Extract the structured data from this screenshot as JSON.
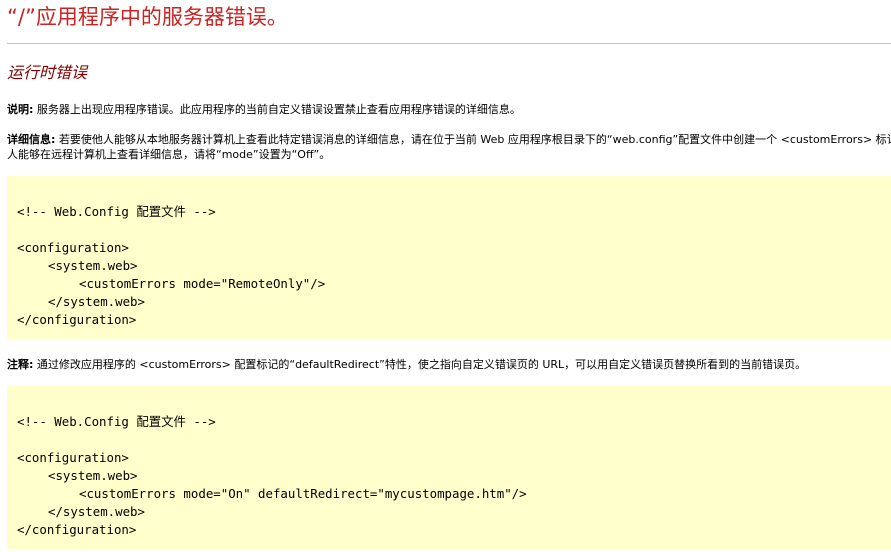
{
  "header": {
    "title": "“/”应用程序中的服务器错误。"
  },
  "error": {
    "heading": "运行时错误",
    "description": {
      "label": "说明:",
      "text": " 服务器上出现应用程序错误。此应用程序的当前自定义错误设置禁止查看应用程序错误的详细信息。"
    },
    "details": {
      "label": "详细信息:",
      "line1": " 若要使他人能够从本地服务器计算机上查看此特定错误消息的详细信息，请在位于当前 Web 应用程序根目录下的“web.config”配置文件中创建一个 <customErrors> 标记。然后应将此 <customErrors> 标记的“mode”特性设置为“Off”。",
      "line2": "人能够在远程计算机上查看详细信息，请将“mode”设置为“Off”。"
    },
    "notes": {
      "label": "注释:",
      "text": " 通过修改应用程序的 <customErrors> 配置标记的“defaultRedirect”特性，使之指向自定义错误页的 URL，可以用自定义错误页替换所看到的当前错误页。"
    }
  },
  "code_blocks": [
    {
      "lines": [
        "<!-- Web.Config 配置文件 -->",
        "",
        "<configuration>",
        "<system.web>",
        "<customErrors mode=\"RemoteOnly\"/>",
        "</system.web>",
        "</configuration>"
      ]
    },
    {
      "lines": [
        "<!-- Web.Config 配置文件 -->",
        "",
        "<configuration>",
        "<system.web>",
        "<customErrors mode=\"On\" defaultRedirect=\"mycustompage.htm\"/>",
        "</system.web>",
        "</configuration>"
      ]
    }
  ],
  "colors": {
    "title": "#cc2222",
    "heading": "#800000",
    "code_background": "#ffffcc",
    "rule": "#c0c0c0"
  }
}
